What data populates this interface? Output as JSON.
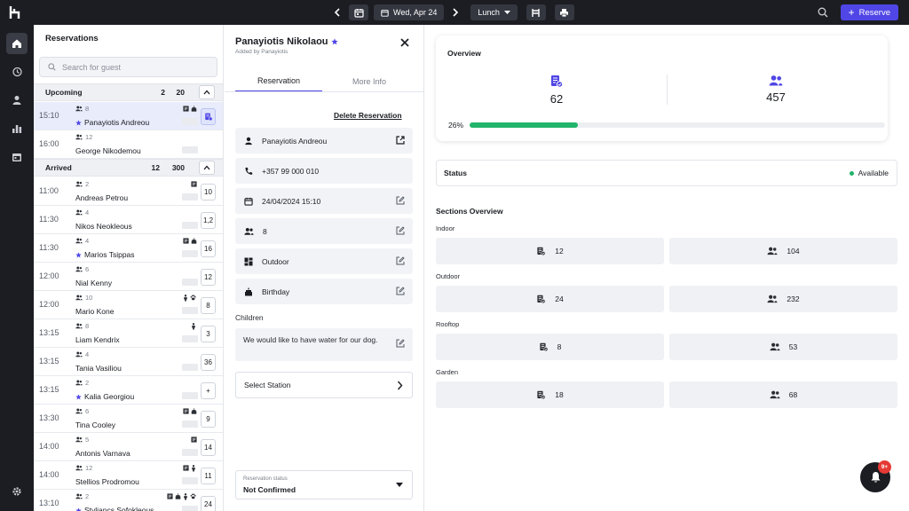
{
  "topbar": {
    "date_label": "Wed, Apr 24",
    "meal_label": "Lunch",
    "reserve_label": "Reserve"
  },
  "icons": {
    "logo": "app-logo",
    "prev": "chevron-left-icon",
    "calendar": "calendar-icon",
    "next": "chevron-right-icon",
    "floor": "chair-icon",
    "print": "printer-icon",
    "search": "search-icon"
  },
  "reservations_panel": {
    "title": "Reservations",
    "search_placeholder": "Search for guest",
    "upcoming": {
      "label": "Upcoming",
      "count_reservations": "2",
      "count_guests": "20"
    },
    "arrived": {
      "label": "Arrived",
      "count_reservations": "12",
      "count_guests": "300"
    },
    "upcoming_rows": [
      {
        "time": "15:10",
        "guests": "8",
        "name": "Panayiotis Andreou",
        "star": true,
        "tags": [
          "note",
          "cake"
        ],
        "table": "",
        "selected": true
      },
      {
        "time": "16:00",
        "guests": "12",
        "name": "George Nikodemou",
        "star": false,
        "tags": [],
        "table": "",
        "selected": false
      }
    ],
    "arrived_rows": [
      {
        "time": "11:00",
        "guests": "2",
        "name": "Andreas Petrou",
        "star": false,
        "tags": [
          "note"
        ],
        "table": "10"
      },
      {
        "time": "11:30",
        "guests": "4",
        "name": "Nikos Neokleous",
        "star": false,
        "tags": [],
        "table": "1,2"
      },
      {
        "time": "11:30",
        "guests": "4",
        "name": "Marios Tsippas",
        "star": true,
        "tags": [
          "note",
          "cake"
        ],
        "table": "16"
      },
      {
        "time": "12:00",
        "guests": "6",
        "name": "Nial Kenny",
        "star": false,
        "tags": [],
        "table": "12"
      },
      {
        "time": "12:00",
        "guests": "10",
        "name": "Mario Kone",
        "star": false,
        "tags": [
          "child",
          "pet"
        ],
        "table": "8"
      },
      {
        "time": "13:15",
        "guests": "8",
        "name": "Liam Kendrix",
        "star": false,
        "tags": [
          "child"
        ],
        "table": "3"
      },
      {
        "time": "13:15",
        "guests": "4",
        "name": "Tania Vasiliou",
        "star": false,
        "tags": [],
        "table": "36"
      },
      {
        "time": "13:15",
        "guests": "2",
        "name": "Kalia Georgiou",
        "star": true,
        "tags": [],
        "table": "+"
      },
      {
        "time": "13:30",
        "guests": "6",
        "name": "Tina Cooley",
        "star": false,
        "tags": [
          "note",
          "cake"
        ],
        "table": "9"
      },
      {
        "time": "14:00",
        "guests": "5",
        "name": "Antonis Varnava",
        "star": false,
        "tags": [
          "note"
        ],
        "table": "14"
      },
      {
        "time": "14:00",
        "guests": "12",
        "name": "Stellios Prodromou",
        "star": false,
        "tags": [
          "note",
          "child"
        ],
        "table": "11"
      },
      {
        "time": "13:10",
        "guests": "2",
        "name": "Styliancs Sofokleous",
        "star": true,
        "tags": [
          "note",
          "cake",
          "child",
          "pet"
        ],
        "table": "24"
      }
    ]
  },
  "detail": {
    "guest_name": "Panayiotis Nikolaou",
    "added_by": "Added by Panayiotis",
    "tabs": [
      "Reservation",
      "More Info"
    ],
    "delete_label": "Delete Reservation",
    "name_field": "Panayiotis Andreou",
    "phone": "+357  99 000 010",
    "datetime": "24/04/2024 15:10",
    "party_size": "8",
    "section": "Outdoor",
    "occasion": "Birthday",
    "children_label": "Children",
    "note": "We would like to have water for our dog.",
    "station_label": "Select Station",
    "status_label": "Reservation status",
    "status_value": "Not Confirmed"
  },
  "overview": {
    "title": "Overview",
    "reservations": "62",
    "guests": "457",
    "progress_label": "26%",
    "progress": 0.26
  },
  "status": {
    "label": "Status",
    "value": "Available",
    "color": "#22b46a"
  },
  "sections": {
    "title": "Sections Overview",
    "items": [
      {
        "name": "Indoor",
        "reservations": "12",
        "guests": "104"
      },
      {
        "name": "Outdoor",
        "reservations": "24",
        "guests": "232"
      },
      {
        "name": "Rooftop",
        "reservations": "8",
        "guests": "53"
      },
      {
        "name": "Garden",
        "reservations": "18",
        "guests": "68"
      }
    ]
  },
  "notifications": {
    "badge": "9+"
  },
  "colors": {
    "accent": "#4f46e5",
    "success": "#22b46a",
    "dark": "#1b1d22",
    "badge": "#e53935"
  }
}
